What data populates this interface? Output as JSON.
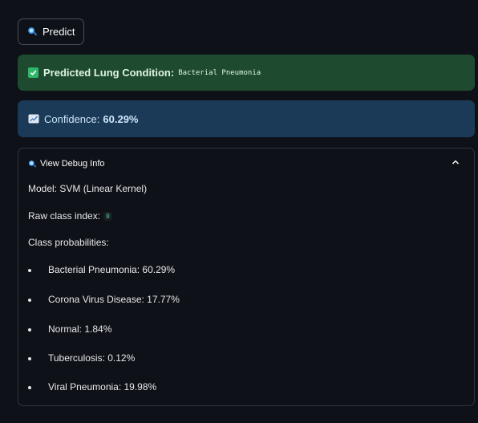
{
  "predict_button": {
    "label": "Predict",
    "icon": "magnifier-icon"
  },
  "success_alert": {
    "label": "Predicted Lung Condition:",
    "value": "Bacterial Pneumonia",
    "icon": "check-box-icon",
    "color": "#1e4a2f"
  },
  "info_alert": {
    "label": "Confidence:",
    "value": "60.29%",
    "icon": "chart-increasing-icon",
    "color": "#1a3a57"
  },
  "debug": {
    "title": "View Debug Info",
    "expanded": true,
    "model_line": "Model: SVM (Linear Kernel)",
    "raw_label": "Raw class index:",
    "raw_value": "0",
    "probs_heading": "Class probabilities:",
    "probabilities": [
      "Bacterial Pneumonia: 60.29%",
      "Corona Virus Disease: 17.77%",
      "Normal: 1.84%",
      "Tuberculosis: 0.12%",
      "Viral Pneumonia: 19.98%"
    ]
  },
  "colors": {
    "background": "#0e1117",
    "accent": "#2fb768",
    "info": "#1a3a57"
  }
}
